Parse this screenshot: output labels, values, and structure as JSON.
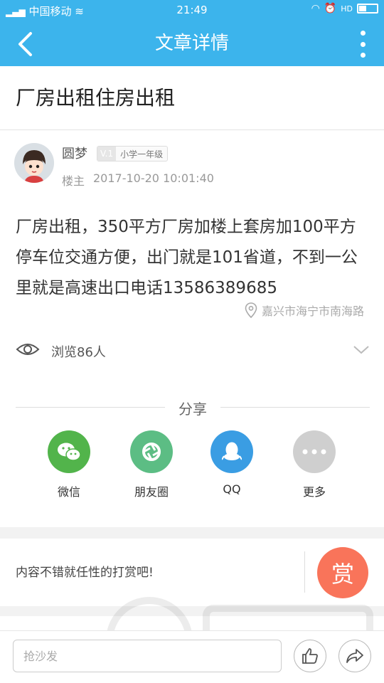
{
  "status_bar": {
    "carrier": "中国移动",
    "time": "21:49",
    "network_tag": "HD"
  },
  "nav": {
    "title": "文章详情",
    "back_icon": "chevron-left-icon",
    "more_icon": "more-vertical-icon"
  },
  "article": {
    "title": "厂房出租住房出租",
    "author": {
      "name": "圆梦",
      "level_code": "V.1",
      "level_name": "小学一年级",
      "role": "楼主",
      "time": "2017-10-20 10:01:40"
    },
    "content": "厂房出租，350平方厂房加楼上套房加100平方停车位交通方便，出门就是101省道，不到一公里就是高速出口电话13586389685",
    "location": "嘉兴市海宁市南海路",
    "views": "浏览86人"
  },
  "share": {
    "label": "分享",
    "items": [
      {
        "name": "微信",
        "icon": "wechat-icon",
        "color": "#52b44b"
      },
      {
        "name": "朋友圈",
        "icon": "moments-icon",
        "color": "#5cbd84"
      },
      {
        "name": "QQ",
        "icon": "qq-icon",
        "color": "#3a9de3"
      },
      {
        "name": "更多",
        "icon": "more-horizontal-icon",
        "color": "#cfcfcf"
      }
    ]
  },
  "reward": {
    "text": "内容不错就任性的打赏吧!",
    "button": "赏"
  },
  "bottom": {
    "comment_placeholder": "抢沙发",
    "like_icon": "thumb-up-icon",
    "share_icon": "share-arrow-icon"
  },
  "colors": {
    "brand": "#3cb4ec",
    "reward": "#f9745a"
  }
}
